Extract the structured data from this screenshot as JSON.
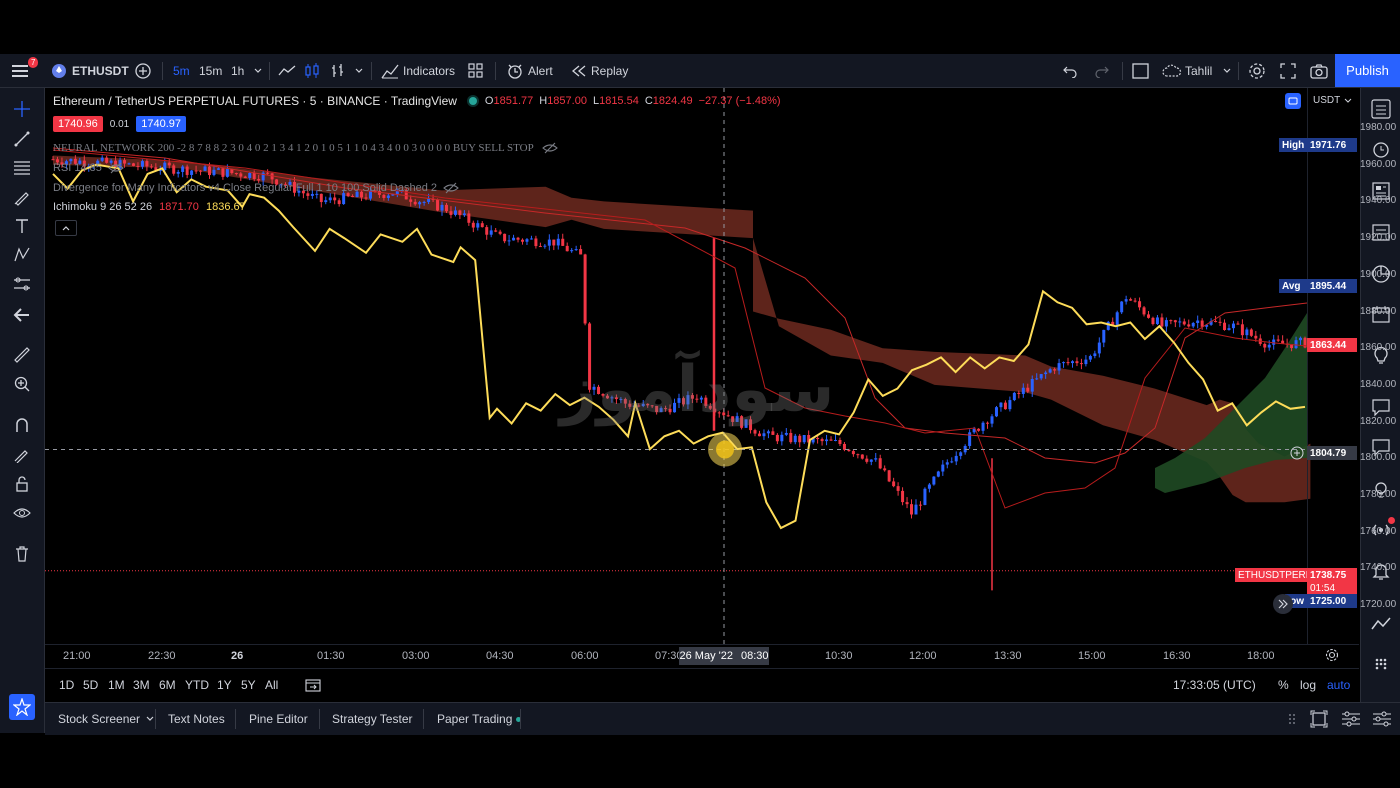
{
  "topbar": {
    "menu_badge": "7",
    "symbol": "ETHUSDT",
    "intervals": [
      "5m",
      "15m",
      "1h"
    ],
    "indicators_label": "Indicators",
    "alert_label": "Alert",
    "replay_label": "Replay",
    "layout_name": "Tahlil",
    "publish_label": "Publish"
  },
  "legend": {
    "title": "Ethereum / TetherUS PERPETUAL FUTURES · 5 · BINANCE · TradingView",
    "open": "1851.77",
    "high": "1857.00",
    "low": "1815.54",
    "close": "1824.49",
    "change": "−27.37 (−1.48%)",
    "bid": "1740.96",
    "spread": "0.01",
    "ask": "1740.97",
    "indicator1": "NEURAL NETWORK 200 -2 8 7 8 8 2 3 0 4 0 2 1 3 4 1 2 0 1 0 5 1 1 0 4 3 4 0 0 3 0 0 0 0 BUY SELL STOP",
    "indicator2a": "RSI 14 85",
    "indicator3": "Divergence for Many Indicators v4 Close Regular Full 1 10 100 Solid Dashed 2",
    "indicator4_name": "Ichimoku 9 26 52 26",
    "indicator4_v1": "1871.70",
    "indicator4_v2": "1836.67"
  },
  "colors": {
    "up": "#2962ff",
    "down": "#f23645",
    "conversion": "#fddc59",
    "cloud_bear": "#6e2a20",
    "cloud_bull": "#1f4a24",
    "publish": "#2962ff"
  },
  "price_axis": {
    "currency": "USDT",
    "labels": [
      "1980.00",
      "1960.00",
      "1940.00",
      "1920.00",
      "1900.00",
      "1880.00",
      "1860.00",
      "1840.00",
      "1820.00",
      "1800.00",
      "1780.00",
      "1760.00",
      "1740.00",
      "1720.00"
    ],
    "high_label": "High",
    "high_value": "1971.76",
    "avg_label": "Avg",
    "avg_value": "1895.44",
    "last_value": "1863.44",
    "crosshair_value": "1804.79",
    "symbol_tag": "ETHUSDTPERP",
    "symbol_price": "1738.75",
    "countdown": "01:54",
    "low_label": "Low",
    "low_value": "1725.00"
  },
  "time_axis": {
    "labels": [
      "21:00",
      "22:30",
      "26",
      "01:30",
      "03:00",
      "04:30",
      "06:00",
      "07:30",
      "08:30",
      "10:30",
      "12:00",
      "13:30",
      "15:00",
      "16:30",
      "18:00"
    ],
    "crosshair_date": "26 May '22",
    "crosshair_time": "08:30"
  },
  "range_bar": {
    "ranges": [
      "1D",
      "5D",
      "1M",
      "3M",
      "6M",
      "YTD",
      "1Y",
      "5Y",
      "All"
    ],
    "clock": "17:33:05 (UTC)",
    "percent": "%",
    "log": "log",
    "auto": "auto"
  },
  "bottom_tabs": [
    "Stock Screener",
    "Text Notes",
    "Pine Editor",
    "Strategy Tester",
    "Paper Trading"
  ],
  "watermark": "سودآموز",
  "chart_data": {
    "type": "line",
    "series": [],
    "y_range": [
      1715,
      1985
    ],
    "x_labels": [
      "21:00",
      "22:30",
      "26",
      "01:30",
      "03:00",
      "04:30",
      "06:00",
      "07:30",
      "08:30",
      "10:30",
      "12:00",
      "13:30",
      "15:00",
      "16:30",
      "18:00"
    ],
    "price_line": 1738.75,
    "crosshair_price": 1804.79,
    "conversion_line": [
      [
        0,
        1955
      ],
      [
        2,
        1947
      ],
      [
        4,
        1957
      ],
      [
        6,
        1960
      ],
      [
        9,
        1958
      ],
      [
        11,
        1940
      ],
      [
        13,
        1955
      ],
      [
        15,
        1958
      ],
      [
        17,
        1945
      ],
      [
        19,
        1952
      ],
      [
        21,
        1948
      ],
      [
        24,
        1946
      ],
      [
        26,
        1937
      ],
      [
        27,
        1944
      ],
      [
        29,
        1942
      ],
      [
        31,
        1935
      ],
      [
        33,
        1926
      ],
      [
        36,
        1913
      ],
      [
        38,
        1925
      ],
      [
        40,
        1920
      ],
      [
        43,
        1912
      ],
      [
        45,
        1922
      ],
      [
        48,
        1918
      ],
      [
        50,
        1925
      ],
      [
        52,
        1911
      ],
      [
        55,
        1907
      ],
      [
        56,
        1915
      ],
      [
        58,
        1908
      ],
      [
        60,
        1822
      ],
      [
        61,
        1827
      ],
      [
        63,
        1819
      ],
      [
        65,
        1830
      ],
      [
        67,
        1826
      ],
      [
        69,
        1835
      ],
      [
        71,
        1829
      ],
      [
        73,
        1833
      ],
      [
        75,
        1828
      ],
      [
        77,
        1821
      ],
      [
        79,
        1812
      ],
      [
        80,
        1830
      ],
      [
        82,
        1805
      ],
      [
        84,
        1812
      ],
      [
        86,
        1815
      ],
      [
        88,
        1808
      ],
      [
        90,
        1812
      ],
      [
        92,
        1814
      ],
      [
        94,
        1805
      ],
      [
        96,
        1806
      ],
      [
        98,
        1776
      ],
      [
        100,
        1762
      ],
      [
        102,
        1766
      ],
      [
        104,
        1810
      ],
      [
        106,
        1815
      ],
      [
        108,
        1813
      ],
      [
        110,
        1825
      ],
      [
        112,
        1843
      ],
      [
        114,
        1834
      ],
      [
        116,
        1838
      ],
      [
        118,
        1848
      ],
      [
        120,
        1851
      ],
      [
        122,
        1855
      ],
      [
        124,
        1847
      ],
      [
        126,
        1855
      ],
      [
        128,
        1849
      ],
      [
        130,
        1855
      ],
      [
        132,
        1853
      ],
      [
        134,
        1862
      ],
      [
        136,
        1891
      ],
      [
        138,
        1885
      ],
      [
        140,
        1882
      ],
      [
        142,
        1873
      ],
      [
        144,
        1874
      ],
      [
        146,
        1872
      ],
      [
        148,
        1874
      ],
      [
        150,
        1865
      ],
      [
        152,
        1872
      ],
      [
        154,
        1863
      ],
      [
        156,
        1852
      ],
      [
        158,
        1843
      ],
      [
        160,
        1826
      ],
      [
        162,
        1830
      ],
      [
        164,
        1818
      ],
      [
        166,
        1825
      ],
      [
        168,
        1831
      ],
      [
        170,
        1827
      ],
      [
        172,
        1828
      ]
    ],
    "close_path": [
      [
        0,
        1963
      ],
      [
        8,
        1960
      ],
      [
        16,
        1957
      ],
      [
        24,
        1954
      ],
      [
        30,
        1940
      ],
      [
        38,
        1945
      ],
      [
        44,
        1936
      ],
      [
        50,
        1920
      ],
      [
        56,
        1918
      ],
      [
        59,
        1910
      ],
      [
        60,
        1840
      ],
      [
        64,
        1830
      ],
      [
        68,
        1826
      ],
      [
        72,
        1834
      ],
      [
        76,
        1822
      ],
      [
        80,
        1812
      ],
      [
        84,
        1810
      ],
      [
        88,
        1808
      ],
      [
        92,
        1798
      ],
      [
        96,
        1770
      ],
      [
        100,
        1798
      ],
      [
        104,
        1820
      ],
      [
        108,
        1835
      ],
      [
        112,
        1850
      ],
      [
        116,
        1855
      ],
      [
        120,
        1888
      ],
      [
        124,
        1872
      ],
      [
        128,
        1875
      ],
      [
        132,
        1872
      ],
      [
        136,
        1862
      ],
      [
        140,
        1863
      ]
    ]
  }
}
